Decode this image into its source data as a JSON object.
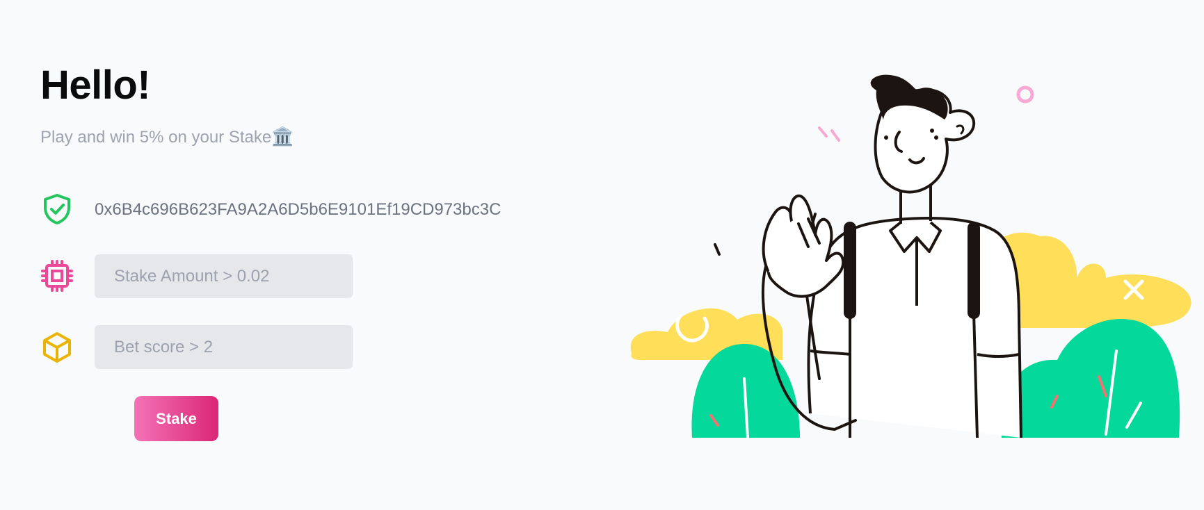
{
  "hero": {
    "title": "Hello!",
    "subtitle": "Play and win 5% on your Stake",
    "subtitle_emoji": "🏛️"
  },
  "wallet": {
    "address": "0x6B4c696B623FA9A2A6D5b6E9101Ef19CD973bc3C",
    "icon": "shield-check-icon"
  },
  "form": {
    "stake_amount": {
      "placeholder": "Stake Amount > 0.02",
      "value": "",
      "icon": "cpu-chip-icon"
    },
    "bet_score": {
      "placeholder": "Bet score > 2",
      "value": "",
      "icon": "cube-icon"
    },
    "submit_label": "Stake"
  },
  "colors": {
    "shield": "#22c55e",
    "chip": "#ec4899",
    "cube": "#eab308",
    "button_start": "#f472b6",
    "button_end": "#db2777",
    "bush": "#04d89a",
    "cloud": "#ffde59"
  }
}
